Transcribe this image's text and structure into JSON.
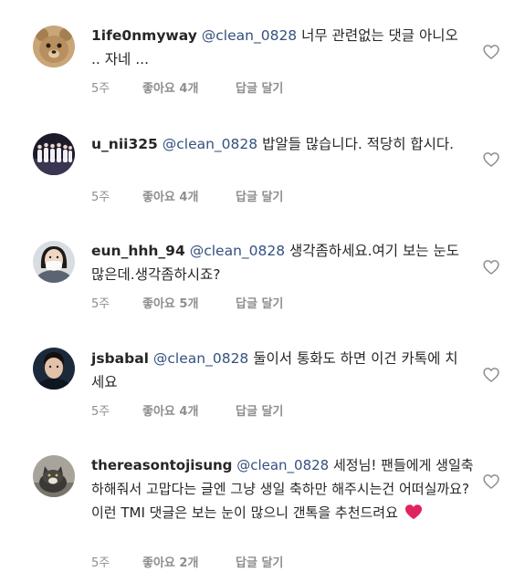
{
  "comments": [
    {
      "username": "1ife0nmyway",
      "mention": "@clean_0828",
      "text": "너무 관련없는 댓글 아니오 .. 자네 ...",
      "time": "5주",
      "likes": "좋아요 4개",
      "reply": "답글 달기",
      "avatar": "teddy-bear-avatar"
    },
    {
      "username": "u_nii325",
      "mention": "@clean_0828",
      "text": "밥알들 많습니다. 적당히 합시다.",
      "time": "5주",
      "likes": "좋아요 4개",
      "reply": "답글 달기",
      "avatar": "group-photo-avatar"
    },
    {
      "username": "eun_hhh_94",
      "mention": "@clean_0828",
      "text": "생각좀하세요.여기 보는 눈도 많은데.생각좀하시죠?",
      "time": "5주",
      "likes": "좋아요 5개",
      "reply": "답글 달기",
      "avatar": "person-mask-avatar"
    },
    {
      "username": "jsbabal",
      "mention": "@clean_0828",
      "text": "둘이서 통화도 하면 이건 카톡에 치세요",
      "time": "5주",
      "likes": "좋아요 4개",
      "reply": "답글 달기",
      "avatar": "person-portrait-avatar"
    },
    {
      "username": "thereasontojisung",
      "mention": "@clean_0828",
      "text": "세정님! 팬들에게 생일축하해줘서 고맙다는 글엔 그냥 생일 축하만 해주시는건 어떠실까요? 이런 TMI 댓글은 보는 눈이 많으니 갠톡을 추천드려요",
      "emoji": "red-heart-emoji",
      "time": "5주",
      "likes": "좋아요 2개",
      "reply": "답글 달기",
      "avatar": "cat-avatar"
    }
  ],
  "icons": {
    "like": "heart-outline-icon"
  },
  "colors": {
    "mention": "#34517f",
    "meta": "#8e8e8e",
    "heart_emoji": "#e0245e"
  }
}
